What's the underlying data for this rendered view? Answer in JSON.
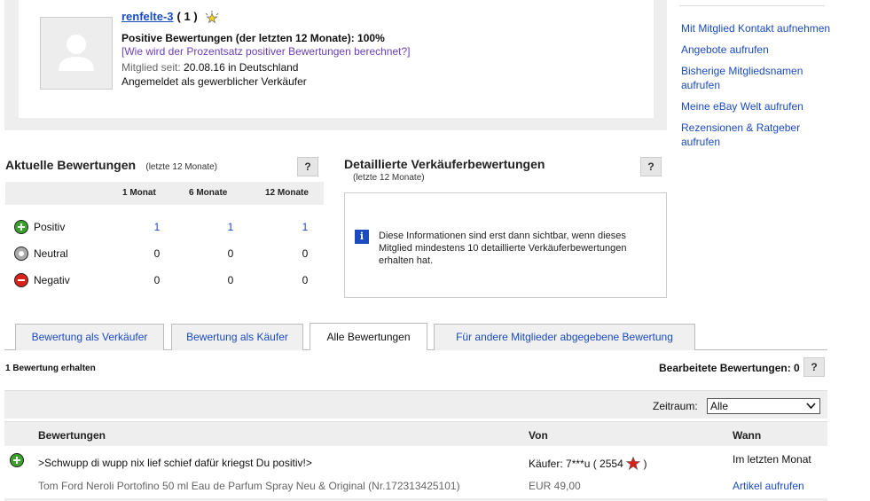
{
  "profile": {
    "username": "renfelte-3",
    "score": "( 1 )",
    "positive_line": "Positive Bewertungen (der letzten 12 Monate): 100%",
    "calc_link": "[Wie wird der Prozentsatz positiver Bewertungen berechnet?]",
    "member_since_label": "Mitglied seit:",
    "member_since_value": "20.08.16 in Deutschland",
    "registered": "Angemeldet als gewerblicher Verkäufer"
  },
  "right_links": [
    "Mit Mitglied Kontakt aufnehmen",
    "Angebote aufrufen",
    "Bisherige Mitgliedsnamen aufrufen",
    "Meine eBay Welt aufrufen",
    "Rezensionen & Ratgeber aufrufen"
  ],
  "current": {
    "title": "Aktuelle Bewertungen",
    "subtitle": "(letzte 12 Monate)",
    "help": "?",
    "columns": [
      "1 Monat",
      "6 Monate",
      "12 Monate"
    ],
    "rows": [
      {
        "label": "Positiv",
        "values": [
          "1",
          "1",
          "1"
        ],
        "icon": "positive-icon"
      },
      {
        "label": "Neutral",
        "values": [
          "0",
          "0",
          "0"
        ],
        "icon": "neutral-icon"
      },
      {
        "label": "Negativ",
        "values": [
          "0",
          "0",
          "0"
        ],
        "icon": "negative-icon"
      }
    ]
  },
  "detailed": {
    "title": "Detaillierte Verkäuferbewertungen",
    "subtitle": "(letzte 12 Monate)",
    "help": "?",
    "info_icon": "i",
    "message": "Diese Informationen sind erst dann sichtbar, wenn dieses Mitglied mindestens 10 detaillierte Verkäuferbewertungen erhalten hat."
  },
  "tabs": [
    {
      "label": "Bewertung als Verkäufer",
      "active": false
    },
    {
      "label": "Bewertung als Käufer",
      "active": false
    },
    {
      "label": "Alle Bewertungen",
      "active": true
    },
    {
      "label": "Für andere Mitglieder abgegebene Bewertung",
      "active": false
    }
  ],
  "received": "1 Bewertung erhalten",
  "edited": "Bearbeitete Bewertungen: 0",
  "edited_help": "?",
  "filter": {
    "label": "Zeitraum:",
    "selected": "Alle"
  },
  "table": {
    "headers": [
      "Bewertungen",
      "Von",
      "Wann"
    ],
    "rows": [
      {
        "comment": ">Schwupp di wupp nix lief schief dafür kriegst Du positiv!>",
        "from_prefix": "Käufer: 7***u ( 2554",
        "from_suffix": ")",
        "when": "Im letzten Monat",
        "item": "Tom Ford Neroli Portofino 50 ml Eau de Parfum Spray Neu & Original (Nr.172313425101)",
        "price": "EUR 49,00",
        "item_link": "Artikel aufrufen"
      }
    ]
  },
  "colors": {
    "link": "#1a4bbf",
    "visited": "#6b3fb5",
    "panel": "#eeeeee"
  }
}
